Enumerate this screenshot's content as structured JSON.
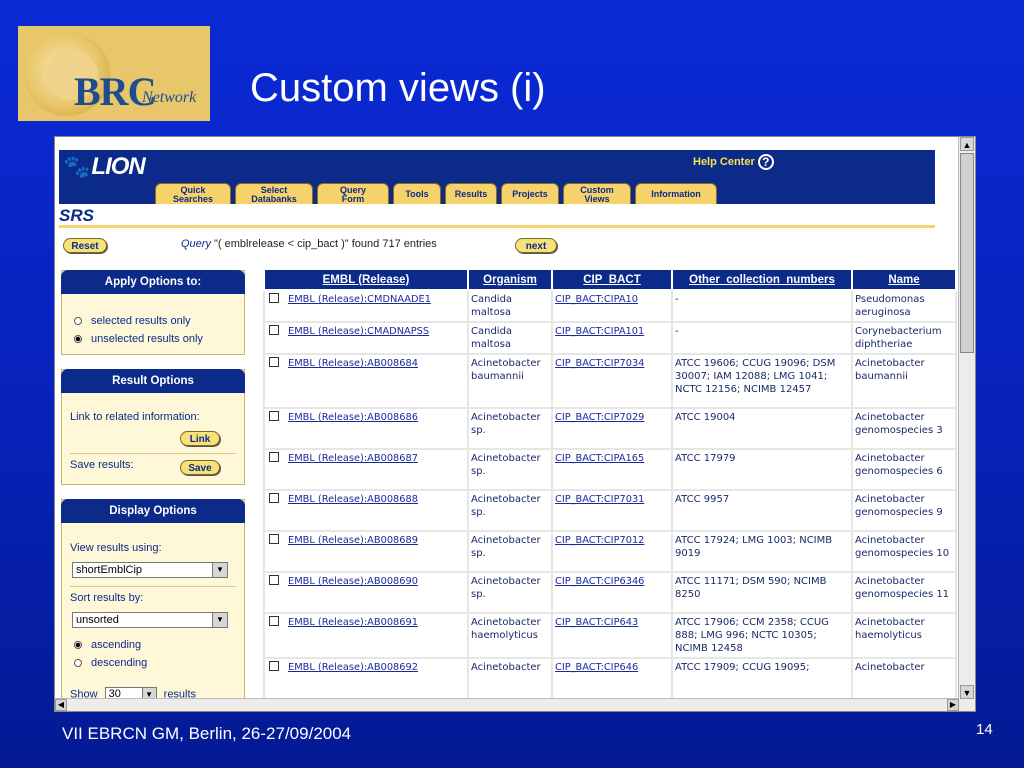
{
  "slide": {
    "title": "Custom views (i)",
    "footer": "VII EBRCN GM, Berlin, 26-27/09/2004",
    "page_number": "14",
    "logo": {
      "brc": "BRC",
      "network": "Network"
    }
  },
  "app": {
    "brand": "LION",
    "help_center": "Help Center",
    "srs_label": "SRS",
    "tabs": [
      {
        "line1": "Quick",
        "line2": "Searches"
      },
      {
        "line1": "Select",
        "line2": "Databanks"
      },
      {
        "line1": "Query",
        "line2": "Form"
      },
      {
        "line1": "Tools",
        "line2": ""
      },
      {
        "line1": "Results",
        "line2": ""
      },
      {
        "line1": "Projects",
        "line2": ""
      },
      {
        "line1": "Custom",
        "line2": "Views"
      },
      {
        "line1": "Information",
        "line2": ""
      }
    ],
    "reset_label": "Reset",
    "next_label": "next",
    "query_prefix": "Query",
    "query_text": " \"( emblrelease < cip_bact )\" found 717 entries"
  },
  "apply_options": {
    "header": "Apply Options to:",
    "selected_only": "selected results only",
    "unselected_only": "unselected results only"
  },
  "result_options": {
    "header": "Result Options",
    "link_label": "Link to related information:",
    "link_button": "Link",
    "save_label": "Save results:",
    "save_button": "Save"
  },
  "display_options": {
    "header": "Display Options",
    "view_label": "View results using:",
    "view_value": "shortEmblCip",
    "sort_label": "Sort results by:",
    "sort_value": "unsorted",
    "ascending": "ascending",
    "descending": "descending",
    "show_label": "Show",
    "show_value": "30",
    "show_suffix": "results"
  },
  "table": {
    "headers": [
      "EMBL (Release)",
      "Organism",
      "CIP_BACT",
      "Other_collection_numbers",
      "Name"
    ],
    "rows": [
      {
        "embl": "EMBL (Release):CMDNAADE1",
        "org": "Candida maltosa",
        "cip": "CIP_BACT:CIPA10",
        "other": "-",
        "name": "Pseudomonas aeruginosa"
      },
      {
        "embl": "EMBL (Release):CMADNAPSS",
        "org": "Candida maltosa",
        "cip": "CIP_BACT:CIPA101",
        "other": "-",
        "name": "Corynebacterium diphtheriae"
      },
      {
        "embl": "EMBL (Release):AB008684",
        "org": "Acinetobacter baumannii",
        "cip": "CIP_BACT:CIP7034",
        "other": "ATCC 19606; CCUG 19096; DSM 30007; IAM 12088; LMG 1041; NCTC 12156; NCIMB 12457",
        "name": "Acinetobacter baumannii"
      },
      {
        "embl": "EMBL (Release):AB008686",
        "org": "Acinetobacter sp.",
        "cip": "CIP_BACT:CIP7029",
        "other": "ATCC 19004",
        "name": "Acinetobacter genomospecies 3"
      },
      {
        "embl": "EMBL (Release):AB008687",
        "org": "Acinetobacter sp.",
        "cip": "CIP_BACT:CIPA165",
        "other": "ATCC 17979",
        "name": "Acinetobacter genomospecies 6"
      },
      {
        "embl": "EMBL (Release):AB008688",
        "org": "Acinetobacter sp.",
        "cip": "CIP_BACT:CIP7031",
        "other": "ATCC 9957",
        "name": "Acinetobacter genomospecies 9"
      },
      {
        "embl": "EMBL (Release):AB008689",
        "org": "Acinetobacter sp.",
        "cip": "CIP_BACT:CIP7012",
        "other": "ATCC 17924; LMG 1003; NCIMB 9019",
        "name": "Acinetobacter genomospecies 10"
      },
      {
        "embl": "EMBL (Release):AB008690",
        "org": "Acinetobacter sp.",
        "cip": "CIP_BACT:CIP6346",
        "other": "ATCC 11171; DSM 590; NCIMB 8250",
        "name": "Acinetobacter genomospecies 11"
      },
      {
        "embl": "EMBL (Release):AB008691",
        "org": "Acinetobacter haemolyticus",
        "cip": "CIP_BACT:CIP643",
        "other": "ATCC 17906; CCM 2358; CCUG 888; LMG 996; NCTC 10305; NCIMB 12458",
        "name": "Acinetobacter haemolyticus"
      },
      {
        "embl": "EMBL (Release):AB008692",
        "org": "Acinetobacter",
        "cip": "CIP_BACT:CIP646",
        "other": "ATCC 17909; CCUG 19095;",
        "name": "Acinetobacter"
      }
    ]
  },
  "colors": {
    "slide_bg": "#0722b8",
    "app_navy": "#0b2a8a",
    "tab_gold": "#f6d26a",
    "panel_bg": "#fff8d8"
  }
}
